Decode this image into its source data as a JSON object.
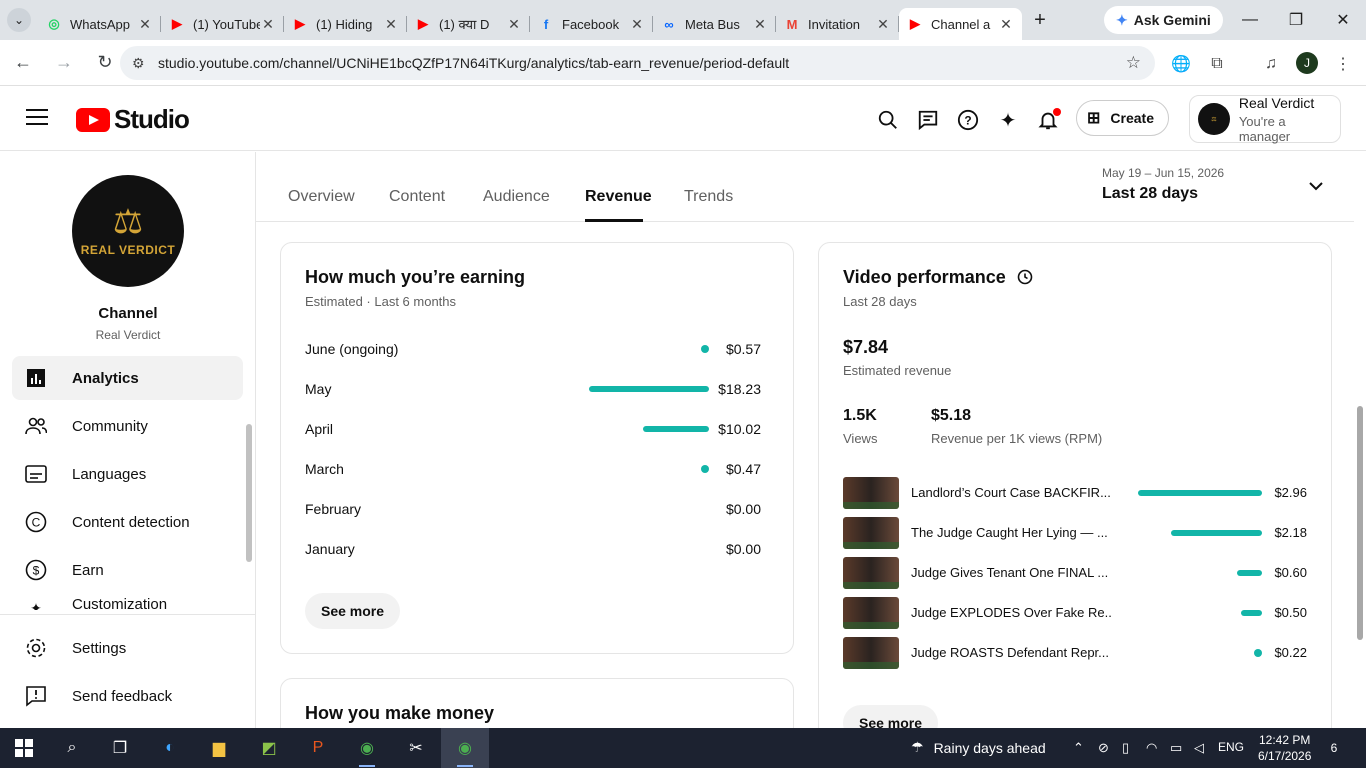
{
  "browser": {
    "tabs": [
      {
        "title": "WhatsApp",
        "icon": "whatsapp-icon",
        "color": "#25d366"
      },
      {
        "title": "(1) YouTube",
        "icon": "youtube-icon",
        "color": "#ff0000"
      },
      {
        "title": "(1) Hiding",
        "icon": "youtube-icon",
        "color": "#ff0000"
      },
      {
        "title": "(1) क्या D",
        "icon": "youtube-icon",
        "color": "#ff0000"
      },
      {
        "title": "Facebook",
        "icon": "facebook-icon",
        "color": "#1877f2"
      },
      {
        "title": "Meta Bus",
        "icon": "meta-icon",
        "color": "#0866ff"
      },
      {
        "title": "Invitation",
        "icon": "gmail-icon",
        "color": "#ea4335"
      },
      {
        "title": "Channel a",
        "icon": "youtube-studio-icon",
        "color": "#ff0000"
      }
    ],
    "gemini_label": "Ask Gemini",
    "url": "studio.youtube.com/channel/UCNiHE1bcQZfP17N64iTKurg/analytics/tab-earn_revenue/period-default",
    "profile_initial": "J"
  },
  "header": {
    "logo_text": "Studio",
    "create_label": "Create",
    "account_name": "Real Verdict",
    "account_role": "You're a manager"
  },
  "sidebar": {
    "channel_title": "Channel",
    "channel_name": "Real Verdict",
    "avatar_brand": "REAL VERDICT",
    "items": [
      {
        "label": "Analytics",
        "icon": "analytics-icon",
        "active": true
      },
      {
        "label": "Community",
        "icon": "community-icon"
      },
      {
        "label": "Languages",
        "icon": "languages-icon"
      },
      {
        "label": "Content detection",
        "icon": "content-detection-icon"
      },
      {
        "label": "Earn",
        "icon": "earn-icon"
      },
      {
        "label": "Customization",
        "icon": "customization-icon"
      }
    ],
    "bottom": [
      {
        "label": "Settings",
        "icon": "settings-icon"
      },
      {
        "label": "Send feedback",
        "icon": "feedback-icon"
      }
    ]
  },
  "tabs": [
    "Overview",
    "Content",
    "Audience",
    "Revenue",
    "Trends"
  ],
  "period": {
    "range": "May 19 – Jun 15, 2026",
    "label": "Last 28 days"
  },
  "earning": {
    "title": "How much you’re earning",
    "subtitle": "Estimated · Last 6 months",
    "months": [
      {
        "label": "June (ongoing)",
        "value": "$0.57",
        "amount": 0.57
      },
      {
        "label": "May",
        "value": "$18.23",
        "amount": 18.23
      },
      {
        "label": "April",
        "value": "$10.02",
        "amount": 10.02
      },
      {
        "label": "March",
        "value": "$0.47",
        "amount": 0.47
      },
      {
        "label": "February",
        "value": "$0.00",
        "amount": 0
      },
      {
        "label": "January",
        "value": "$0.00",
        "amount": 0
      }
    ],
    "see_more": "See more"
  },
  "make_money": {
    "title": "How you make money"
  },
  "video_perf": {
    "title": "Video performance",
    "subtitle": "Last 28 days",
    "revenue": "$7.84",
    "revenue_label": "Estimated revenue",
    "views": "1.5K",
    "views_label": "Views",
    "rpm": "$5.18",
    "rpm_label": "Revenue per 1K views (RPM)",
    "videos": [
      {
        "title": "Landlord’s Court Case BACKFIR...",
        "value": "$2.96",
        "amount": 2.96
      },
      {
        "title": "The Judge Caught Her Lying — ...",
        "value": "$2.18",
        "amount": 2.18
      },
      {
        "title": "Judge Gives Tenant One FINAL ...",
        "value": "$0.60",
        "amount": 0.6
      },
      {
        "title": "Judge EXPLODES Over Fake Re...",
        "value": "$0.50",
        "amount": 0.5
      },
      {
        "title": "Judge ROASTS Defendant Repr...",
        "value": "$0.22",
        "amount": 0.22
      }
    ],
    "see_more": "See more"
  },
  "taskbar": {
    "weather": "Rainy days ahead",
    "lang": "ENG",
    "time": "12:42 PM",
    "date": "6/17/2026",
    "notifications": "6"
  }
}
